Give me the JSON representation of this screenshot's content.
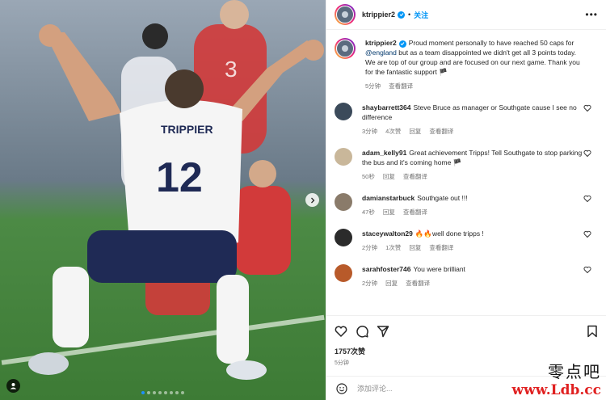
{
  "header": {
    "username": "ktrippier2",
    "separator": "•",
    "follow_label": "关注",
    "more_label": "•••"
  },
  "photo": {
    "jersey_name": "TRIPPIER",
    "jersey_number": "12",
    "slide_count": 8,
    "active_slide": 1
  },
  "caption": {
    "username": "ktrippier2",
    "text_before": "Proud moment personally to have reached 50 caps for ",
    "mention": "@england",
    "text_after": " but as a team disappointed we didn't get all 3 points today. We are top of our group and are focused on our next game. Thank you for the fantastic support 🏴",
    "time": "5分钟",
    "translate": "查看翻译"
  },
  "comments": [
    {
      "username": "shaybarrett364",
      "text": "Steve Bruce as manager or Southgate cause I see no difference",
      "time": "3分钟",
      "likes": "4次赞",
      "reply": "回复",
      "translate": "查看翻译",
      "avatar_color": "#3b4a5a"
    },
    {
      "username": "adam_kelly91",
      "text": "Great achievement Tripps! Tell Southgate to stop parking the bus and it's coming home 🏴",
      "time": "50秒",
      "likes": "",
      "reply": "回复",
      "translate": "查看翻译",
      "avatar_color": "#c9b79a"
    },
    {
      "username": "damianstarbuck",
      "text": "Southgate out !!!",
      "time": "47秒",
      "likes": "",
      "reply": "回复",
      "translate": "查看翻译",
      "avatar_color": "#8a7b6a"
    },
    {
      "username": "staceywalton29",
      "text": "🔥🔥well done tripps !",
      "time": "2分钟",
      "likes": "1次赞",
      "reply": "回复",
      "translate": "查看翻译",
      "avatar_color": "#2b2b2b"
    },
    {
      "username": "sarahfoster746",
      "text": "You were brilliant",
      "time": "2分钟",
      "likes": "",
      "reply": "回复",
      "translate": "查看翻译",
      "avatar_color": "#b85a2a"
    }
  ],
  "footer": {
    "likes": "1757次赞",
    "time": "5分钟",
    "add_comment_placeholder": "添加评论..."
  },
  "watermark": {
    "cn": "零点吧",
    "url": "www.Ldb.cc"
  },
  "colors": {
    "accent": "#0095f6",
    "watermark_url": "#e02020"
  }
}
